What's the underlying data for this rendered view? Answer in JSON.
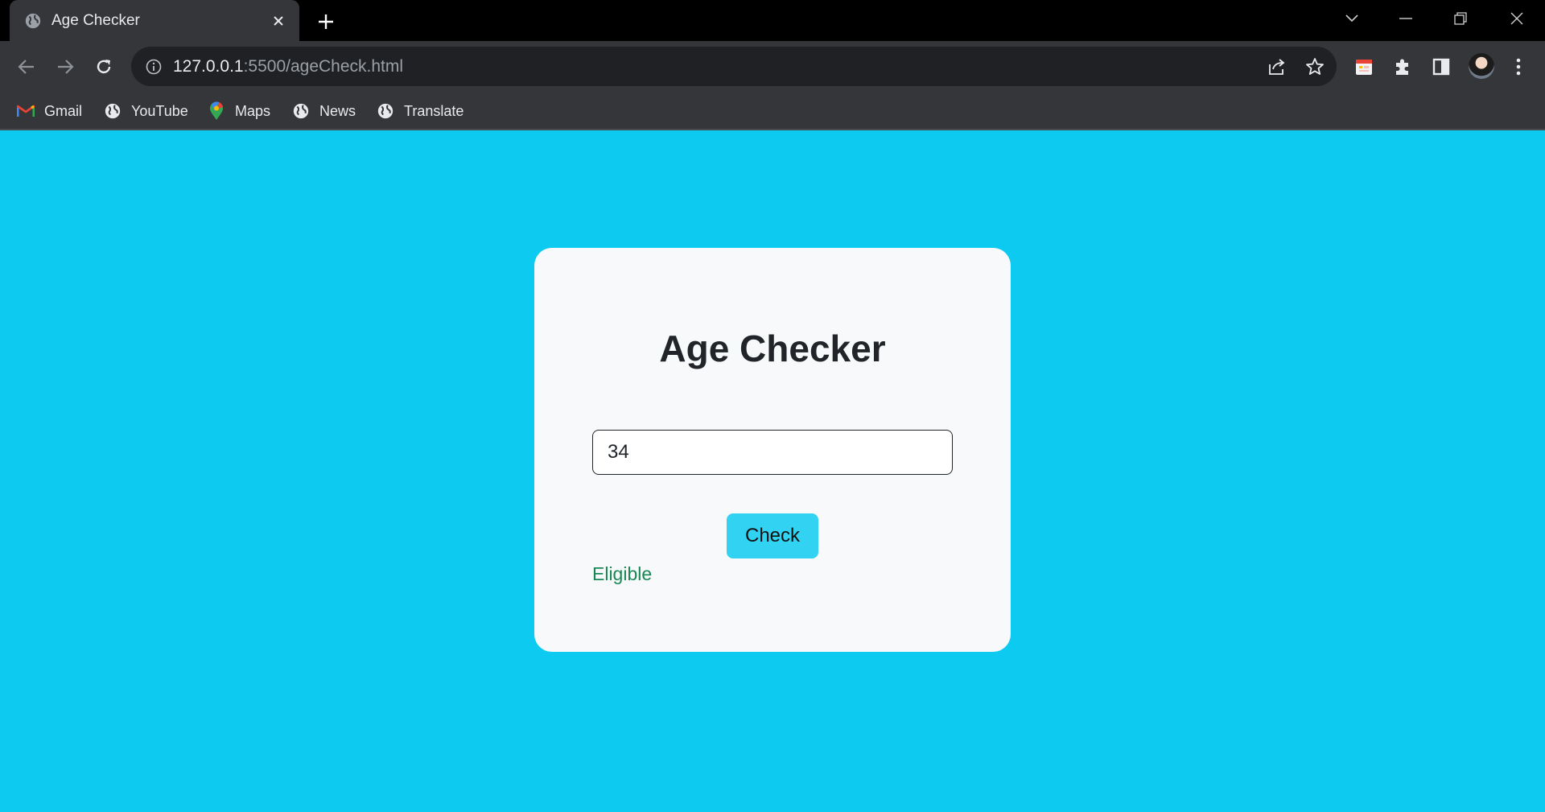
{
  "browser": {
    "tab": {
      "title": "Age Checker",
      "favicon": "globe-icon"
    },
    "address": {
      "host": "127.0.0.1",
      "rest": ":5500/ageCheck.html"
    },
    "bookmarks": [
      {
        "label": "Gmail",
        "icon": "gmail-icon"
      },
      {
        "label": "YouTube",
        "icon": "globe-icon"
      },
      {
        "label": "Maps",
        "icon": "maps-pin-icon"
      },
      {
        "label": "News",
        "icon": "globe-icon"
      },
      {
        "label": "Translate",
        "icon": "globe-icon"
      }
    ]
  },
  "page": {
    "background": "#0dcaf0",
    "title": "Age Checker",
    "age_input_value": "34",
    "check_label": "Check",
    "check_color": "#31d2f2",
    "result": "Eligible",
    "result_color": "#198754"
  }
}
